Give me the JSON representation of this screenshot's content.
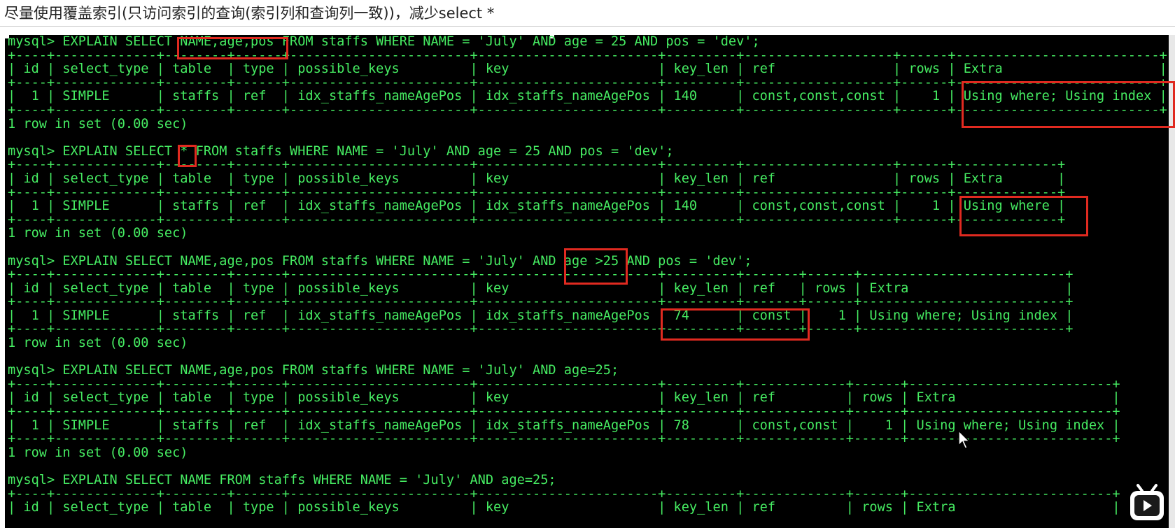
{
  "heading": "尽量使用覆盖索引(只访问索引的查询(索引列和查询列一致))，减少select *",
  "terminal_lines": [
    "mysql> EXPLAIN SELECT NAME,age,pos FROM staffs WHERE NAME = 'July' AND age = 25 AND pos = 'dev';",
    "+----+-------------+--------+------+-----------------------+-----------------------+---------+-------------------+------+--------------------------+",
    "| id | select_type | table  | type | possible_keys         | key                   | key_len | ref               | rows | Extra                    |",
    "+----+-------------+--------+------+-----------------------+-----------------------+---------+-------------------+------+--------------------------+",
    "|  1 | SIMPLE      | staffs | ref  | idx_staffs_nameAgePos | idx_staffs_nameAgePos | 140     | const,const,const |    1 | Using where; Using index |",
    "+----+-------------+--------+------+-----------------------+-----------------------+---------+-------------------+------+--------------------------+",
    "1 row in set (0.00 sec)",
    "",
    "mysql> EXPLAIN SELECT * FROM staffs WHERE NAME = 'July' AND age = 25 AND pos = 'dev';",
    "+----+-------------+--------+------+-----------------------+-----------------------+---------+-------------------+------+-------------+",
    "| id | select_type | table  | type | possible_keys         | key                   | key_len | ref               | rows | Extra       |",
    "+----+-------------+--------+------+-----------------------+-----------------------+---------+-------------------+------+-------------+",
    "|  1 | SIMPLE      | staffs | ref  | idx_staffs_nameAgePos | idx_staffs_nameAgePos | 140     | const,const,const |    1 | Using where |",
    "+----+-------------+--------+------+-----------------------+-----------------------+---------+-------------------+------+-------------+",
    "1 row in set (0.00 sec)",
    "",
    "mysql> EXPLAIN SELECT NAME,age,pos FROM staffs WHERE NAME = 'July' AND age >25 AND pos = 'dev';",
    "+----+-------------+--------+------+-----------------------+-----------------------+---------+-------+------+--------------------------+",
    "| id | select_type | table  | type | possible_keys         | key                   | key_len | ref   | rows | Extra                    |",
    "+----+-------------+--------+------+-----------------------+-----------------------+---------+-------+------+--------------------------+",
    "|  1 | SIMPLE      | staffs | ref  | idx_staffs_nameAgePos | idx_staffs_nameAgePos | 74      | const |    1 | Using where; Using index |",
    "+----+-------------+--------+------+-----------------------+-----------------------+---------+-------+------+--------------------------+",
    "1 row in set (0.00 sec)",
    "",
    "mysql> EXPLAIN SELECT NAME,age,pos FROM staffs WHERE NAME = 'July' AND age=25;",
    "+----+-------------+--------+------+-----------------------+-----------------------+---------+-------------+------+--------------------------+",
    "| id | select_type | table  | type | possible_keys         | key                   | key_len | ref         | rows | Extra                    |",
    "+----+-------------+--------+------+-----------------------+-----------------------+---------+-------------+------+--------------------------+",
    "|  1 | SIMPLE      | staffs | ref  | idx_staffs_nameAgePos | idx_staffs_nameAgePos | 78      | const,const |    1 | Using where; Using index |",
    "+----+-------------+--------+------+-----------------------+-----------------------+---------+-------------+------+--------------------------+",
    "1 row in set (0.00 sec)",
    "",
    "mysql> EXPLAIN SELECT NAME FROM staffs WHERE NAME = 'July' AND age=25;",
    "+----+-------------+--------+------+-----------------------+-----------------------+---------+-------------+------+--------------------------+",
    "| id | select_type | table  | type | possible_keys         | key                   | key_len | ref         | rows | Extra                    |"
  ],
  "colors": {
    "terminal_bg": "#000000",
    "terminal_text": "#46ec62",
    "highlight": "#e02a20"
  },
  "icons": {
    "cursor": "mouse-pointer-icon",
    "logo": "video-player-logo"
  }
}
